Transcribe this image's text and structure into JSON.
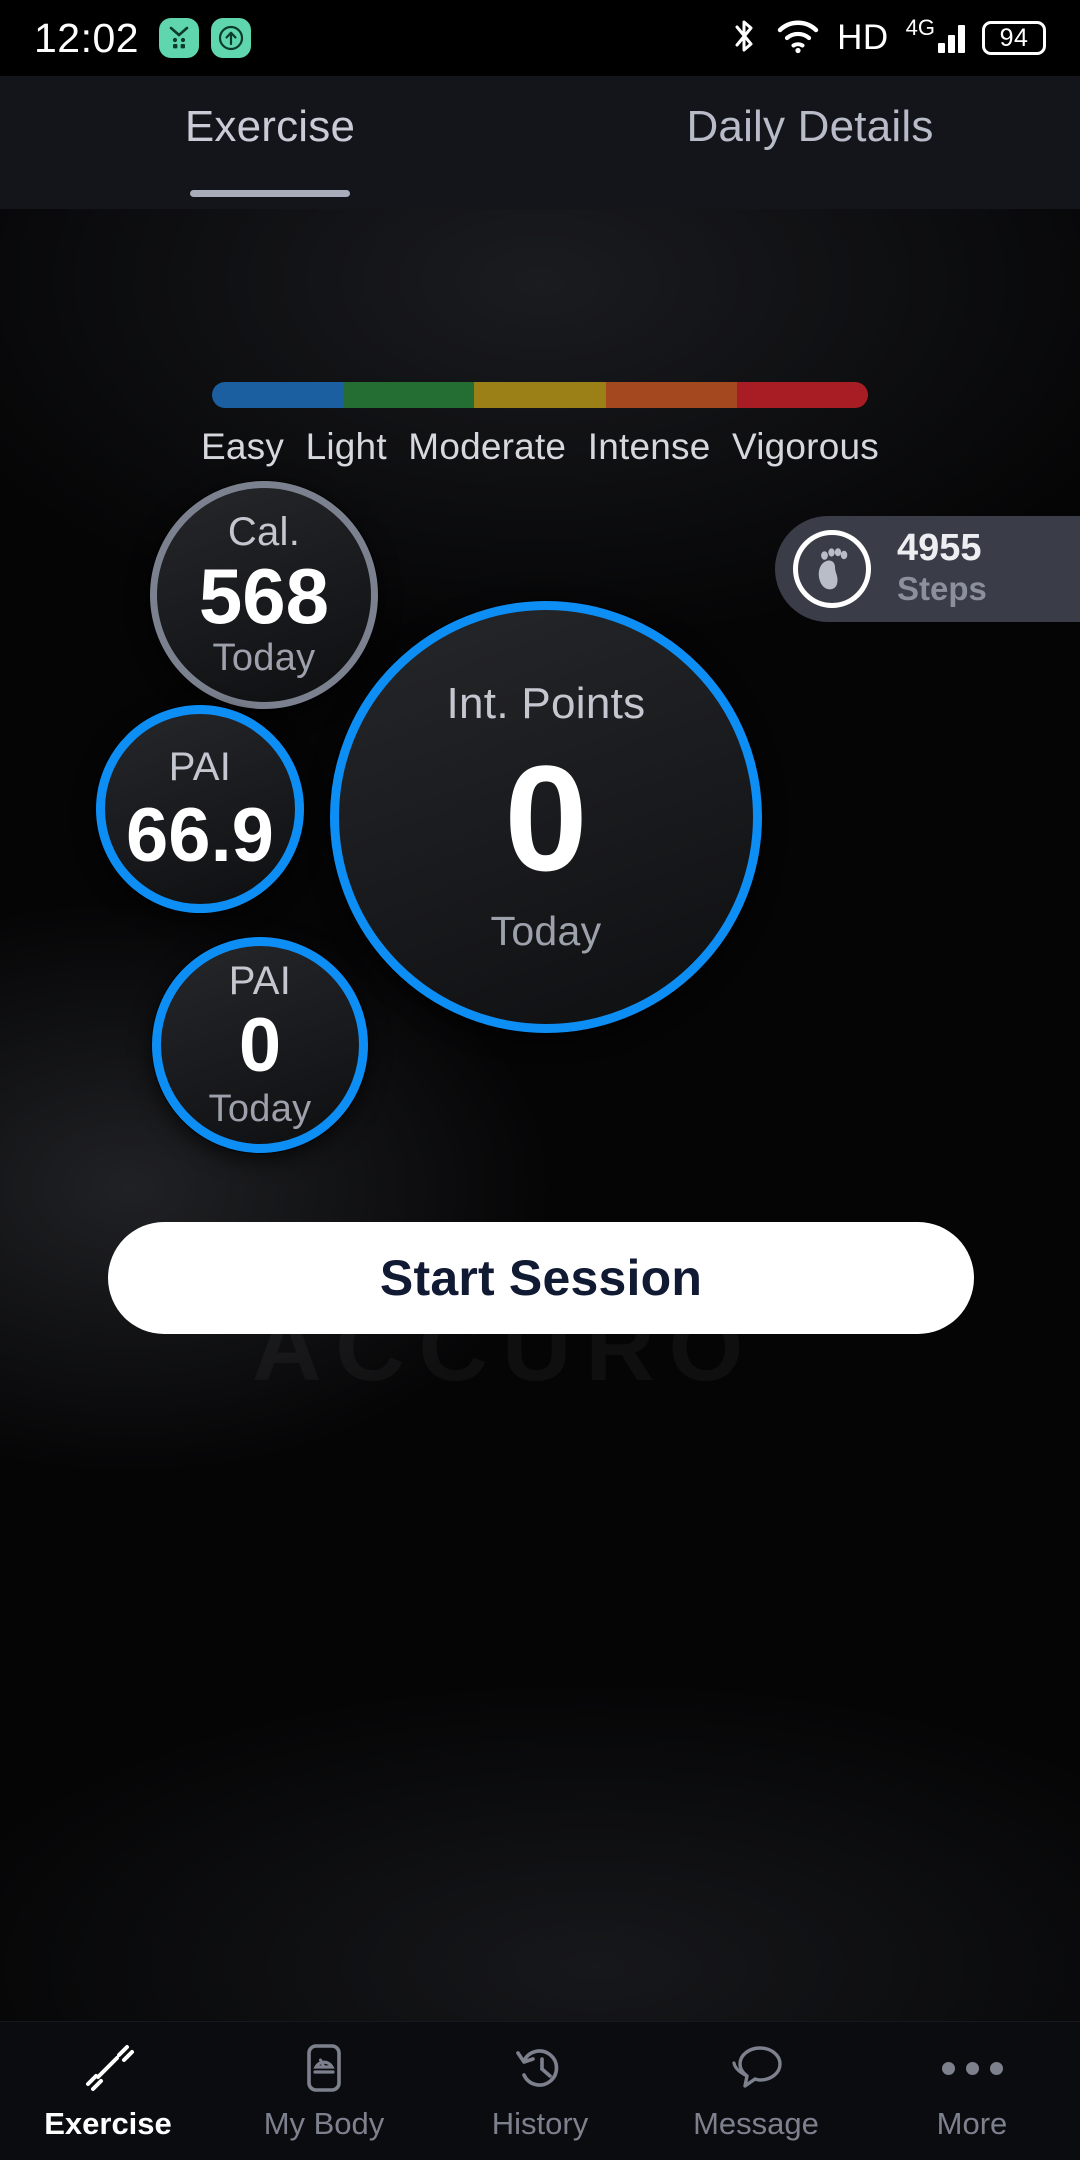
{
  "status_bar": {
    "time": "12:02",
    "left_icons": [
      "app-badge-icon",
      "upload-badge-icon"
    ],
    "bluetooth_icon": "bluetooth-icon",
    "wifi_icon": "wifi-icon",
    "hd_label": "HD",
    "network_label": "4G",
    "network_superscript": "+",
    "battery_level": "94",
    "accent_badge_color": "#5fd6ad"
  },
  "tabs": [
    {
      "label": "Exercise",
      "active": true
    },
    {
      "label": "Daily Details",
      "active": false
    }
  ],
  "intensity": {
    "segments": [
      {
        "label": "Easy",
        "color": "#1b5fa0",
        "width_pct": 20
      },
      {
        "label": "Light",
        "color": "#246d33",
        "width_pct": 20
      },
      {
        "label": "Moderate",
        "color": "#9b8017",
        "width_pct": 20
      },
      {
        "label": "Intense",
        "color": "#a4481f",
        "width_pct": 20
      },
      {
        "label": "Vigorous",
        "color": "#a81c23",
        "width_pct": 20
      }
    ]
  },
  "steps": {
    "icon": "footprint-icon",
    "count": "4955",
    "label": "Steps"
  },
  "metrics": {
    "calories": {
      "title": "Cal.",
      "value": "568",
      "sub": "Today",
      "ring_color": "#7c818f"
    },
    "pai_main": {
      "title": "PAI",
      "value": "66.9",
      "ring_color": "#0d8ef5"
    },
    "pai_today": {
      "title": "PAI",
      "value": "0",
      "sub": "Today",
      "ring_color": "#0d8ef5"
    },
    "int_points": {
      "title": "Int. Points",
      "value": "0",
      "sub": "Today",
      "ring_color": "#0d8ef5"
    }
  },
  "background_watermark": "ACCURO",
  "start_button": {
    "label": "Start Session"
  },
  "bottom_nav": [
    {
      "label": "Exercise",
      "icon": "dumbbell-icon",
      "active": true
    },
    {
      "label": "My Body",
      "icon": "scale-icon",
      "active": false
    },
    {
      "label": "History",
      "icon": "clock-history-icon",
      "active": false
    },
    {
      "label": "Message",
      "icon": "chat-bubbles-icon",
      "active": false
    },
    {
      "label": "More",
      "icon": "more-dots-icon",
      "active": false
    }
  ]
}
